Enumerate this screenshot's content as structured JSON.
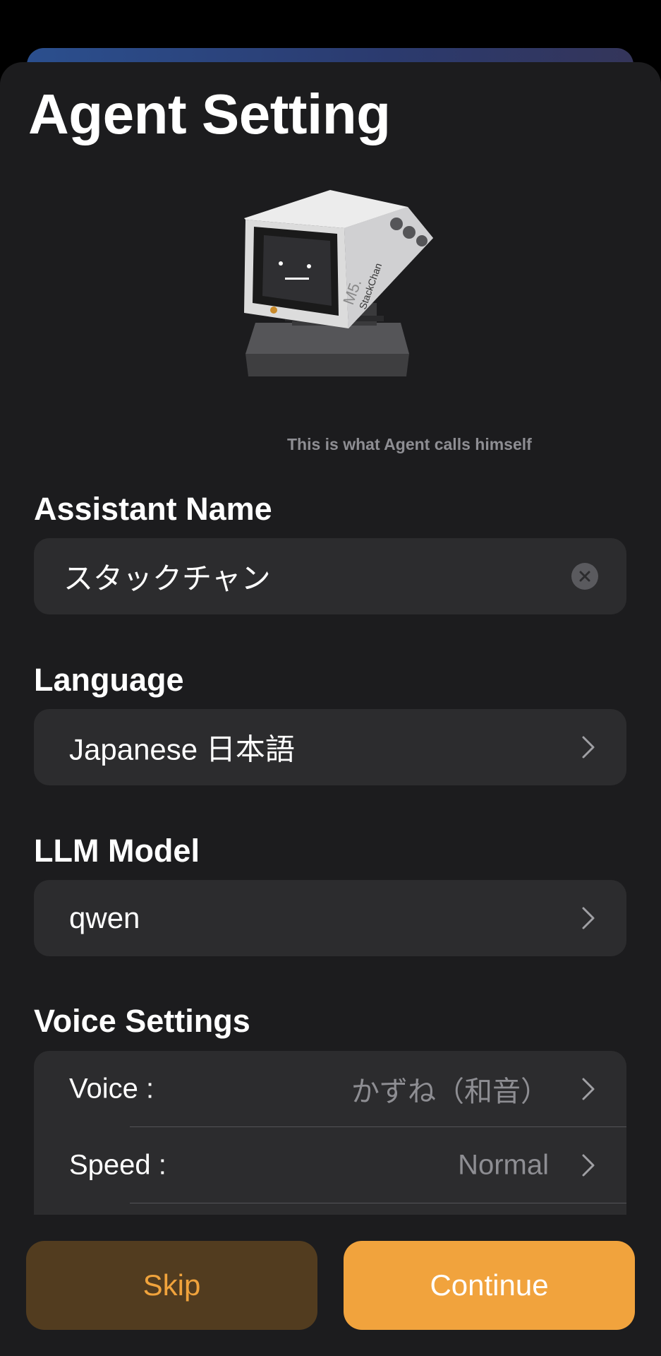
{
  "header": {
    "title": "Agent Setting"
  },
  "assistant_name": {
    "label": "Assistant Name",
    "hint": "This is what Agent calls himself",
    "value": "スタックチャン"
  },
  "language": {
    "label": "Language",
    "value": "Japanese 日本語"
  },
  "llm_model": {
    "label": "LLM Model",
    "value": "qwen"
  },
  "voice_settings": {
    "label": "Voice Settings",
    "rows": [
      {
        "label": "Voice :",
        "value": "かずね（和音）"
      },
      {
        "label": "Speed :",
        "value": "Normal"
      }
    ]
  },
  "footer": {
    "skip_label": "Skip",
    "continue_label": "Continue"
  },
  "colors": {
    "accent": "#f1a33d",
    "background": "#1c1c1e",
    "field": "#2c2c2e"
  },
  "device_screen": {
    "brand_text": "M5.",
    "name_text": "StackChan"
  }
}
